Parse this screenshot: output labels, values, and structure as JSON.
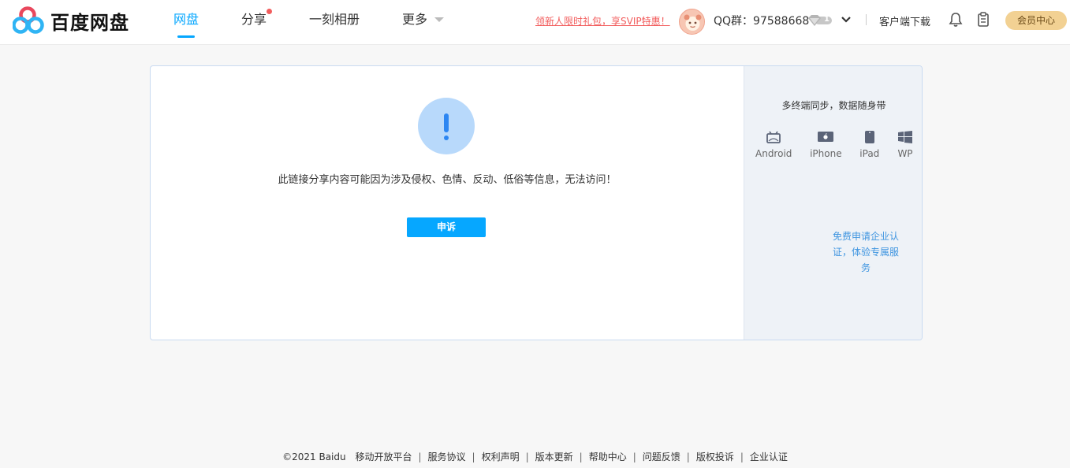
{
  "header": {
    "logo_text": "百度网盘",
    "nav": [
      {
        "label": "网盘",
        "active": true
      },
      {
        "label": "分享",
        "badge_dot": true
      },
      {
        "label": "一刻相册"
      },
      {
        "label": "更多",
        "caret": true
      }
    ],
    "promo_text": "领新人限时礼包，享SVIP特惠！",
    "user_name": "QQ群：97588668",
    "vip_level": "1",
    "client_download": "客户端下载",
    "member_center": "会员中心"
  },
  "notice": {
    "message": "此链接分享内容可能因为涉及侵权、色情、反动、低俗等信息，无法访问！",
    "appeal_label": "申诉"
  },
  "side_panel": {
    "title": "多终端同步，数据随身带",
    "platforms": [
      {
        "label": "Android",
        "icon": "android-icon"
      },
      {
        "label": "iPhone",
        "icon": "apple-icon"
      },
      {
        "label": "iPad",
        "icon": "ipad-icon"
      },
      {
        "label": "WP",
        "icon": "windows-icon"
      }
    ],
    "enterprise_link": "免费申请企业认证，体验专属服务"
  },
  "footer": {
    "copyright": "©2021 Baidu",
    "links": [
      "移动开放平台",
      "服务协议",
      "权利声明",
      "版本更新",
      "帮助中心",
      "问题反馈",
      "版权投诉",
      "企业认证"
    ]
  },
  "colors": {
    "accent": "#06a7ff",
    "promo": "#f25d5d",
    "member_bg": "#f2d193",
    "side_bg": "#eef2f7",
    "link": "#3f95e0"
  }
}
